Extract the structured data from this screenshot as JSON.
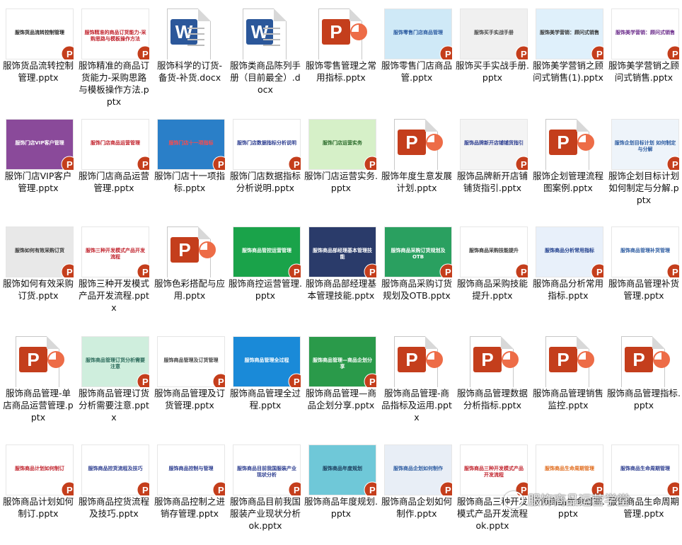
{
  "files": [
    {
      "name": "服饰货品流转控制管理.pptx",
      "thumb": "slide",
      "title": "服饰货品流转控制管理",
      "bg": "#ffffff",
      "fg": "#222222"
    },
    {
      "name": "服饰精准的商品订货能力-采购思路与模板操作方法.pptx",
      "thumb": "slide",
      "title": "服饰精准的商品订货能力-采购思路与模板操作方法",
      "bg": "#ffffff",
      "fg": "#c0202a"
    },
    {
      "name": "服饰科学的订货-备货-补货.docx",
      "thumb": "word"
    },
    {
      "name": "服饰类商品陈列手册（目前最全）.docx",
      "thumb": "word"
    },
    {
      "name": "服饰零售管理之常用指标.pptx",
      "thumb": "ppt"
    },
    {
      "name": "服饰零售门店商品管.pptx",
      "thumb": "slide",
      "title": "服饰零售门店商品管理",
      "bg": "#cfe9f7",
      "fg": "#2a5aa0"
    },
    {
      "name": "服饰买手实战手册.pptx",
      "thumb": "slide",
      "title": "服饰买手实战手册",
      "bg": "#f0f0f0",
      "fg": "#444444"
    },
    {
      "name": "服饰美学营销之顾问式销售(1).pptx",
      "thumb": "slide",
      "title": "服饰美学营销：顾问式销售",
      "bg": "#dff0fb",
      "fg": "#333333"
    },
    {
      "name": "服饰美学营销之顾问式销售.pptx",
      "thumb": "slide",
      "title": "服饰美学营销：顾问式销售",
      "bg": "#ffffff",
      "fg": "#6a2a8a"
    },
    {
      "name": "服饰门店VIP客户管理.pptx",
      "thumb": "slide",
      "title": "服饰门店VIP客户管理",
      "bg": "#8a4a9a",
      "fg": "#ffffff"
    },
    {
      "name": "服饰门店商品运营管理.pptx",
      "thumb": "slide",
      "title": "服饰门店商品运营管理",
      "bg": "#ffffff",
      "fg": "#c0202a"
    },
    {
      "name": "服饰门店十一项指标.pptx",
      "thumb": "slide",
      "title": "服饰门店十一项指标",
      "bg": "#2a7fc8",
      "fg": "#ff4a4a"
    },
    {
      "name": "服饰门店数据指标分析说明.pptx",
      "thumb": "slide",
      "title": "服饰门店数据指标分析说明",
      "bg": "#ffffff",
      "fg": "#2a3b8f"
    },
    {
      "name": "服饰门店运营实务.pptx",
      "thumb": "slide",
      "title": "服饰门店运营实务",
      "bg": "#d6f0c8",
      "fg": "#2a6a2a"
    },
    {
      "name": "服饰年度生意发展计划.pptx",
      "thumb": "ppt"
    },
    {
      "name": "服饰品牌新开店铺铺货指引.pptx",
      "thumb": "slide",
      "title": "服饰品牌新开店铺铺货指引",
      "bg": "#f4f4f4",
      "fg": "#2a3b8f"
    },
    {
      "name": "服饰企划管理流程图案例.pptx",
      "thumb": "ppt"
    },
    {
      "name": "服饰企划目标计划如何制定与分解.pptx",
      "thumb": "slide",
      "title": "服饰企划目标计划 如何制定与分解",
      "bg": "#eef4fa",
      "fg": "#2a5aa0"
    },
    {
      "name": "服饰如何有效采购订货.pptx",
      "thumb": "slide",
      "title": "服饰如何有效采购订货",
      "bg": "#e8e8e8",
      "fg": "#333333"
    },
    {
      "name": "服饰三种开发模式产品开发流程.pptx",
      "thumb": "slide",
      "title": "服饰三种开发模式产品开发流程",
      "bg": "#ffffff",
      "fg": "#c0202a"
    },
    {
      "name": "服饰色彩搭配与应用.pptx",
      "thumb": "ppt"
    },
    {
      "name": "服饰商控运营管理.pptx",
      "thumb": "slide",
      "title": "服饰商品管控运营管理",
      "bg": "#1aa34a",
      "fg": "#ffffff"
    },
    {
      "name": "服饰商品部经理基本管理技能.pptx",
      "thumb": "slide",
      "title": "服饰商品部经理基本管理技能",
      "bg": "#2a3b6a",
      "fg": "#ffffff"
    },
    {
      "name": "服饰商品采购订货规划及OTB.pptx",
      "thumb": "slide",
      "title": "服饰商品采购订货规划及OTB",
      "bg": "#2aa060",
      "fg": "#ffffff"
    },
    {
      "name": "服饰商品采购技能提升.pptx",
      "thumb": "slide",
      "title": "服饰商品采购技能提升",
      "bg": "#ffffff",
      "fg": "#333333"
    },
    {
      "name": "服饰商品分析常用指标.pptx",
      "thumb": "slide",
      "title": "服饰商品分析常用指标",
      "bg": "#e8f0fa",
      "fg": "#1a3a8a"
    },
    {
      "name": "服饰商品管理补货管理.pptx",
      "thumb": "slide",
      "title": "服饰商品管理补货管理",
      "bg": "#ffffff",
      "fg": "#2a5aa0"
    },
    {
      "name": "服饰商品管理-单店商品运营管理.pptx",
      "thumb": "ppt"
    },
    {
      "name": "服饰商品管理订货分析需要注意.pptx",
      "thumb": "slide",
      "title": "服饰商品管理订货分析需要注意",
      "bg": "#cfeedd",
      "fg": "#2a6a5a"
    },
    {
      "name": "服饰商品管理及订货管理.pptx",
      "thumb": "slide",
      "title": "服饰商品管理及订货管理",
      "bg": "#ffffff",
      "fg": "#444444"
    },
    {
      "name": "服饰商品管理全过程.pptx",
      "thumb": "slide",
      "title": "服饰商品管理全过程",
      "bg": "#1a8ad8",
      "fg": "#ffffff"
    },
    {
      "name": "服饰商品管理—商品企划分享.pptx",
      "thumb": "slide",
      "title": "服饰商品管理—商品企划分享",
      "bg": "#2a9a4a",
      "fg": "#ffffff"
    },
    {
      "name": "服饰商品管理-商品指标及运用.pptx",
      "thumb": "ppt"
    },
    {
      "name": "服饰商品管理数据分析指标.pptx",
      "thumb": "ppt"
    },
    {
      "name": "服饰商品管理销售监控.pptx",
      "thumb": "ppt"
    },
    {
      "name": "服饰商品管理指标.pptx",
      "thumb": "ppt"
    },
    {
      "name": "服饰商品计划如何制订.pptx",
      "thumb": "slide",
      "title": "服饰商品计划如何制订",
      "bg": "#ffffff",
      "fg": "#c0202a"
    },
    {
      "name": "服饰商品控货流程及技巧.pptx",
      "thumb": "slide",
      "title": "服饰商品控货流程及技巧",
      "bg": "#ffffff",
      "fg": "#2a3b8f"
    },
    {
      "name": "服饰商品控制之进销存管理.pptx",
      "thumb": "slide",
      "title": "服饰商品控制与管理",
      "bg": "#ffffff",
      "fg": "#2a3b8f"
    },
    {
      "name": "服饰商品目前我国服装产业现状分析ok.pptx",
      "thumb": "slide",
      "title": "服饰商品目前我国服装产业现状分析",
      "bg": "#ffffff",
      "fg": "#2a3b8f"
    },
    {
      "name": "服饰商品年度规划.pptx",
      "thumb": "slide",
      "title": "服饰商品年度规划",
      "bg": "#6fc8d8",
      "fg": "#1a3a5a"
    },
    {
      "name": "服饰商品企划如何制作.pptx",
      "thumb": "slide",
      "title": "服饰商品企划如何制作",
      "bg": "#e8eef6",
      "fg": "#2a5aa0"
    },
    {
      "name": "服饰商品三种开发模式产品开发流程ok.pptx",
      "thumb": "slide",
      "title": "服饰商品三种开发模式产品开发流程",
      "bg": "#ffffff",
      "fg": "#c0202a"
    },
    {
      "name": "服饰商品生命周期.pptx",
      "thumb": "slide",
      "title": "服饰商品生命周期管理",
      "bg": "#ffffff",
      "fg": "#e06a1a"
    },
    {
      "name": "服饰商品生命周期管理.pptx",
      "thumb": "slide",
      "title": "服饰商品生命周期管理",
      "bg": "#ffffff",
      "fg": "#2a3b8f"
    }
  ],
  "watermark": {
    "text": "服饰商品运营学堂",
    "icon": "wechat-icon"
  },
  "colors": {
    "ppt": "#c43e1c",
    "pptAccent": "#ed6c47",
    "word": "#2b579a"
  }
}
